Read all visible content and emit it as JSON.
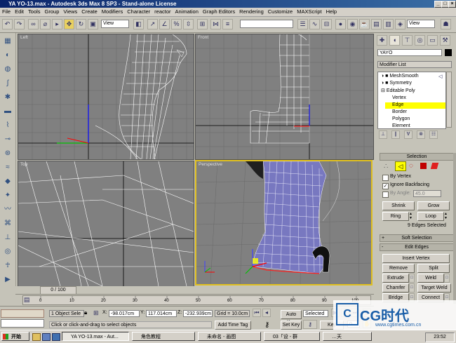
{
  "window": {
    "title": "YA YO-13.max - Autodesk 3ds Max 8 SP3 - Stand-alone License"
  },
  "menu": [
    "File",
    "Edit",
    "Tools",
    "Group",
    "Views",
    "Create",
    "Modifiers",
    "Character",
    "reactor",
    "Animation",
    "Graph Editors",
    "Rendering",
    "Customize",
    "MAXScript",
    "Help"
  ],
  "toolbar": {
    "view_dropdown": "View",
    "view_dropdown_right": "View"
  },
  "viewports": {
    "left": "Left",
    "front": "Front",
    "top": "Top",
    "perspective": "Perspective"
  },
  "command_panel": {
    "object_name": "YAYO",
    "modifier_list": "Modifier List",
    "stack": [
      "MeshSmooth",
      "Symmetry",
      "Editable Poly",
      "Vertex",
      "Edge",
      "Border",
      "Polygon",
      "Element"
    ],
    "selected_sublevel": "Edge",
    "selection_header": "Selection",
    "by_vertex": "By Vertex",
    "ignore_backfacing": "Ignore Backfacing",
    "by_angle": "By Angle:",
    "angle_value": "45.0",
    "shrink": "Shrink",
    "grow": "Grow",
    "ring": "Ring",
    "loop": "Loop",
    "status": "9 Edges Selected",
    "soft_selection": "Soft Selection",
    "edit_edges": "Edit Edges",
    "insert_vertex": "Insert Vertex",
    "remove": "Remove",
    "split": "Split",
    "extrude": "Extrude",
    "weld": "Weld",
    "chamfer": "Chamfer",
    "target_weld": "Target Weld",
    "bridge": "Bridge",
    "connect": "Connect"
  },
  "timeline": {
    "frame": "0 / 100",
    "ticks": [
      "0",
      "10",
      "20",
      "30",
      "40",
      "50",
      "60",
      "70",
      "80",
      "90",
      "100"
    ]
  },
  "status": {
    "selection": "1 Object Sele",
    "x_label": "X:",
    "x_value": "-98.017cm",
    "y_label": "Y:",
    "y_value": "117.014cm",
    "z_label": "Z:",
    "z_value": "-232.939cm",
    "grid": "Grid = 10.0cm",
    "prompt": "Click or click-and-drag to select objects",
    "add_time_tag": "Add Time Tag",
    "auto_key": "Auto Key",
    "selected": "Selected",
    "set_key": "Set Key",
    "key_filters": "Key Filters...",
    "frame_value": "0"
  },
  "taskbar": {
    "start": "开始",
    "tasks": [
      "YA YO-13.max - Aut...",
      "角色教程",
      "未命名 - 画图",
      "03「设 - 群",
      "…天"
    ],
    "clock": "23:52"
  },
  "watermark": {
    "logo": "CG时代",
    "url": "www.cgtimes.com.cn"
  },
  "colors": {
    "selection_yellow": "#ffff00",
    "active_border": "#e0c020",
    "title_blue": "#0a246a",
    "mesh_white": "#ffffff",
    "shaded_mesh": "#8080c8"
  }
}
